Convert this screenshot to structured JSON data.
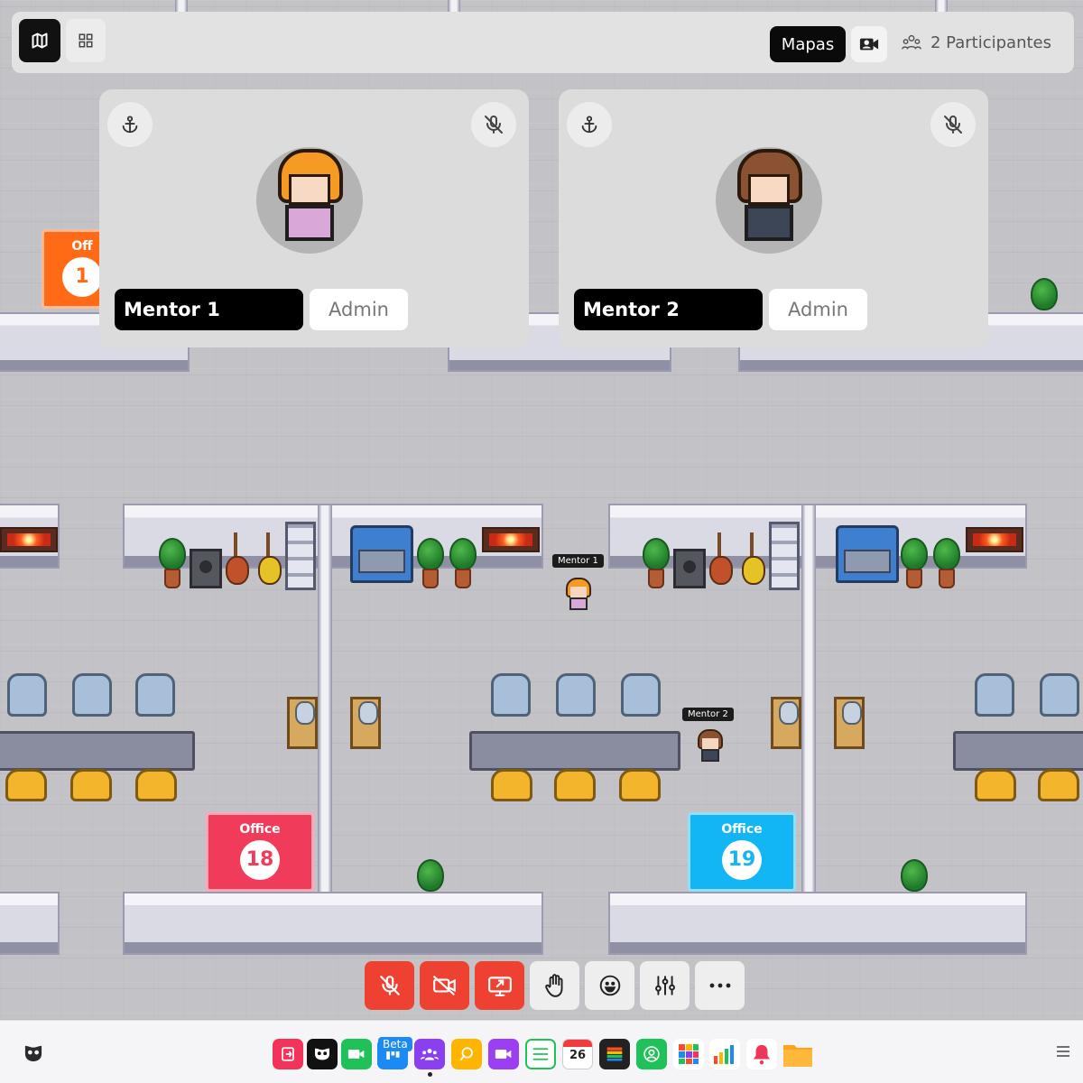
{
  "topbar": {
    "mapas_label": "Mapas",
    "participants_label": "2 Participantes"
  },
  "cards": [
    {
      "name": "Mentor 1",
      "role": "Admin",
      "hair_color": "#f59a23",
      "body_color": "#d9a8d8"
    },
    {
      "name": "Mentor 2",
      "role": "Admin",
      "hair_color": "#8a5233",
      "body_color": "#3d4656"
    }
  ],
  "map": {
    "avatars": [
      {
        "name": "Mentor 1"
      },
      {
        "name": "Mentor 2"
      }
    ],
    "offices": [
      {
        "label": "Office",
        "number": "18",
        "color": "#f03c5a"
      },
      {
        "label": "Office",
        "number": "19",
        "color": "#13b6f5"
      },
      {
        "label": "Off",
        "number": "1",
        "color": "#ff6a17"
      }
    ]
  },
  "controls": [
    {
      "icon": "mic-off-icon",
      "state": "off"
    },
    {
      "icon": "camera-off-icon",
      "state": "off"
    },
    {
      "icon": "screen-share-icon",
      "state": "off"
    },
    {
      "icon": "hand-raise-icon"
    },
    {
      "icon": "emoji-icon"
    },
    {
      "icon": "settings-sliders-icon"
    },
    {
      "icon": "more-icon"
    }
  ],
  "dock": {
    "beta_label": "Beta",
    "calendar_day": "26",
    "apps": [
      {
        "icon": "exit-icon",
        "color": "#f0345a"
      },
      {
        "icon": "mask-icon",
        "color": "#111111"
      },
      {
        "icon": "video-meet-icon",
        "color": "#21c15a"
      },
      {
        "icon": "kanban-icon",
        "color": "#1b8af4"
      },
      {
        "icon": "team-icon",
        "color": "#8a3ff0"
      },
      {
        "icon": "search-bulb-icon",
        "color": "#ffb400"
      },
      {
        "icon": "video-call-icon",
        "color": "#9b3ff0"
      },
      {
        "icon": "list-icon",
        "color": "#21c15a"
      },
      {
        "icon": "calendar-icon",
        "color": "#ffffff"
      },
      {
        "icon": "stack-icon",
        "color": "#222222"
      },
      {
        "icon": "contact-icon",
        "color": "#21c15a"
      },
      {
        "icon": "grid-apps-icon",
        "color": "#ff4a2a"
      },
      {
        "icon": "bar-chart-icon",
        "color": "#ffffff"
      },
      {
        "icon": "bell-icon",
        "color": "#ffffff"
      },
      {
        "icon": "folder-icon",
        "color": "#ffa31a"
      }
    ]
  }
}
